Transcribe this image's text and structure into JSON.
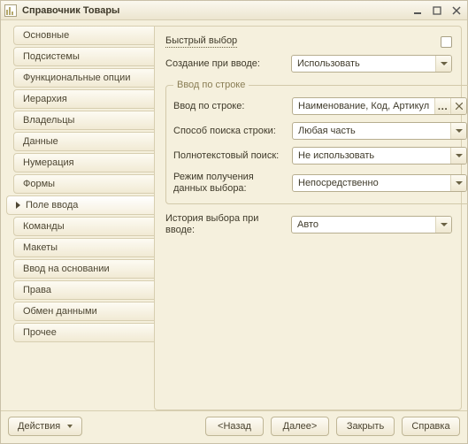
{
  "window": {
    "title": "Справочник Товары"
  },
  "sidebar": {
    "items": [
      {
        "label": "Основные"
      },
      {
        "label": "Подсистемы"
      },
      {
        "label": "Функциональные опции"
      },
      {
        "label": "Иерархия"
      },
      {
        "label": "Владельцы"
      },
      {
        "label": "Данные"
      },
      {
        "label": "Нумерация"
      },
      {
        "label": "Формы"
      },
      {
        "label": "Поле ввода",
        "active": true
      },
      {
        "label": "Команды"
      },
      {
        "label": "Макеты"
      },
      {
        "label": "Ввод на основании"
      },
      {
        "label": "Права"
      },
      {
        "label": "Обмен данными"
      },
      {
        "label": "Прочее"
      }
    ]
  },
  "main": {
    "quick_select": "Быстрый выбор",
    "create_on_input_label": "Создание при вводе:",
    "create_on_input_value": "Использовать",
    "group_legend": "Ввод по строке",
    "input_by_string_label": "Ввод по строке:",
    "input_by_string_value": "Наименование, Код, Артикул",
    "search_method_label": "Способ поиска строки:",
    "search_method_value": "Любая часть",
    "fulltext_label": "Полнотекстовый поиск:",
    "fulltext_value": "Не использовать",
    "fetch_mode_label": "Режим получения данных выбора:",
    "fetch_mode_value": "Непосредственно",
    "history_label": "История выбора при вводе:",
    "history_value": "Авто"
  },
  "footer": {
    "actions": "Действия",
    "back": "<Назад",
    "next": "Далее>",
    "close": "Закрыть",
    "help": "Справка"
  }
}
